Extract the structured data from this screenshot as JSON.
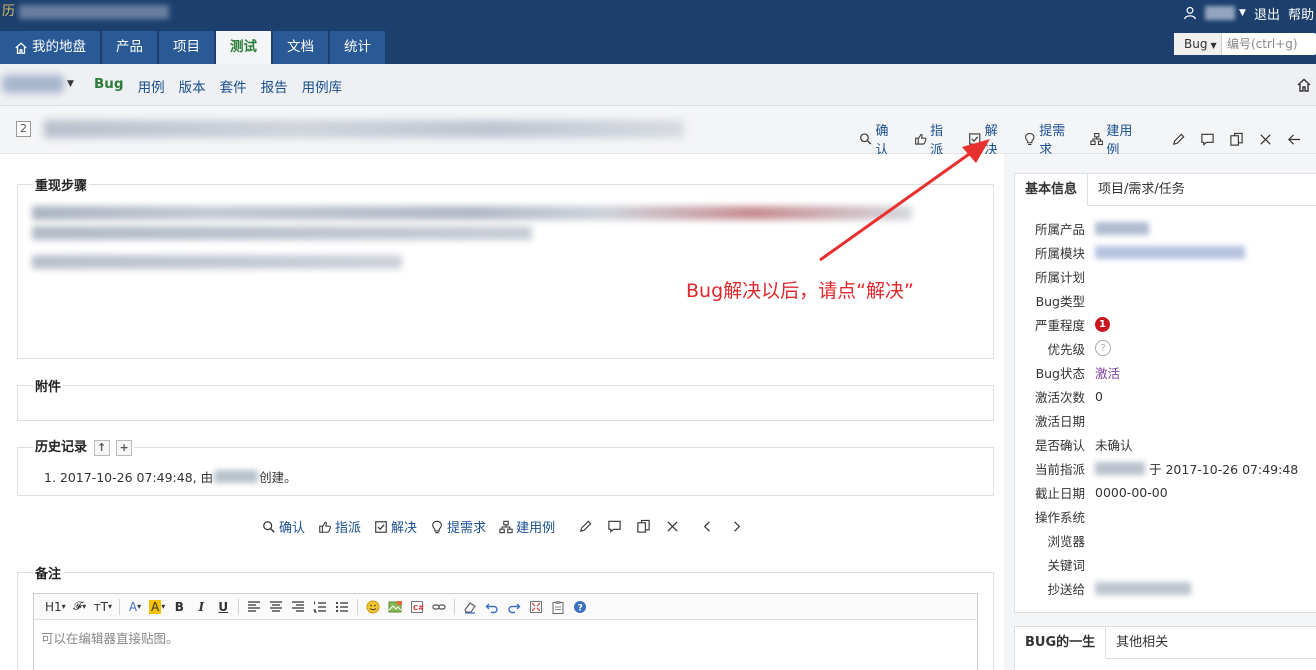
{
  "header": {
    "brand": "历",
    "user_links": {
      "logout": "退出",
      "help": "帮助"
    },
    "search": {
      "type": "Bug",
      "placeholder": "编号(ctrl+g)"
    }
  },
  "mainnav": [
    {
      "label": "我的地盘",
      "icon": "home-icon"
    },
    {
      "label": "产品"
    },
    {
      "label": "项目"
    },
    {
      "label": "测试",
      "active": true
    },
    {
      "label": "文档"
    },
    {
      "label": "统计"
    }
  ],
  "subnav": [
    {
      "label": "Bug",
      "active": true
    },
    {
      "label": "用例"
    },
    {
      "label": "版本"
    },
    {
      "label": "套件"
    },
    {
      "label": "报告"
    },
    {
      "label": "用例库"
    }
  ],
  "bug": {
    "id": "2"
  },
  "actions": {
    "confirm": "确认",
    "assign": "指派",
    "resolve": "解决",
    "to_story": "提需求",
    "create_case": "建用例"
  },
  "sections": {
    "steps": "重现步骤",
    "attachments": "附件",
    "history": "历史记录",
    "comment": "备注"
  },
  "history": {
    "item_prefix": "1. 2017-10-26 07:49:48, 由",
    "item_suffix": "创建。"
  },
  "annotation": "Bug解决以后，请点“解决”",
  "editor": {
    "placeholder": "可以在编辑器直接贴图。",
    "heading_btn": "H1",
    "font_btn": "𝓕",
    "size_btn": "тT",
    "color_btn": "A",
    "bg_btn": "A",
    "bold_btn": "B",
    "italic_btn": "I",
    "underline_btn": "U"
  },
  "side": {
    "tabs": [
      "基本信息",
      "项目/需求/任务"
    ],
    "labels": {
      "product": "所属产品",
      "module": "所属模块",
      "plan": "所属计划",
      "type": "Bug类型",
      "severity": "严重程度",
      "priority": "优先级",
      "status": "Bug状态",
      "activated_count": "激活次数",
      "activated_date": "激活日期",
      "confirmed": "是否确认",
      "assigned_to": "当前指派",
      "deadline": "截止日期",
      "os": "操作系统",
      "browser": "浏览器",
      "keywords": "关键词",
      "cc": "抄送给"
    },
    "values": {
      "severity": "1",
      "priority": "?",
      "status": "激活",
      "activated_count": "0",
      "confirmed": "未确认",
      "assigned_suffix": "于 2017-10-26 07:49:48",
      "deadline": "0000-00-00"
    },
    "tabs2": [
      "BUG的一生",
      "其他相关"
    ]
  },
  "colors": {
    "header_bg": "#1c3f6e",
    "tab_bg": "#2a5a95",
    "active_green": "#2d7d3a",
    "link_blue": "#1a4f8f",
    "annotation_red": "#e0272c",
    "severity_red": "#c8181e",
    "status_purple": "#7a3fa0"
  }
}
